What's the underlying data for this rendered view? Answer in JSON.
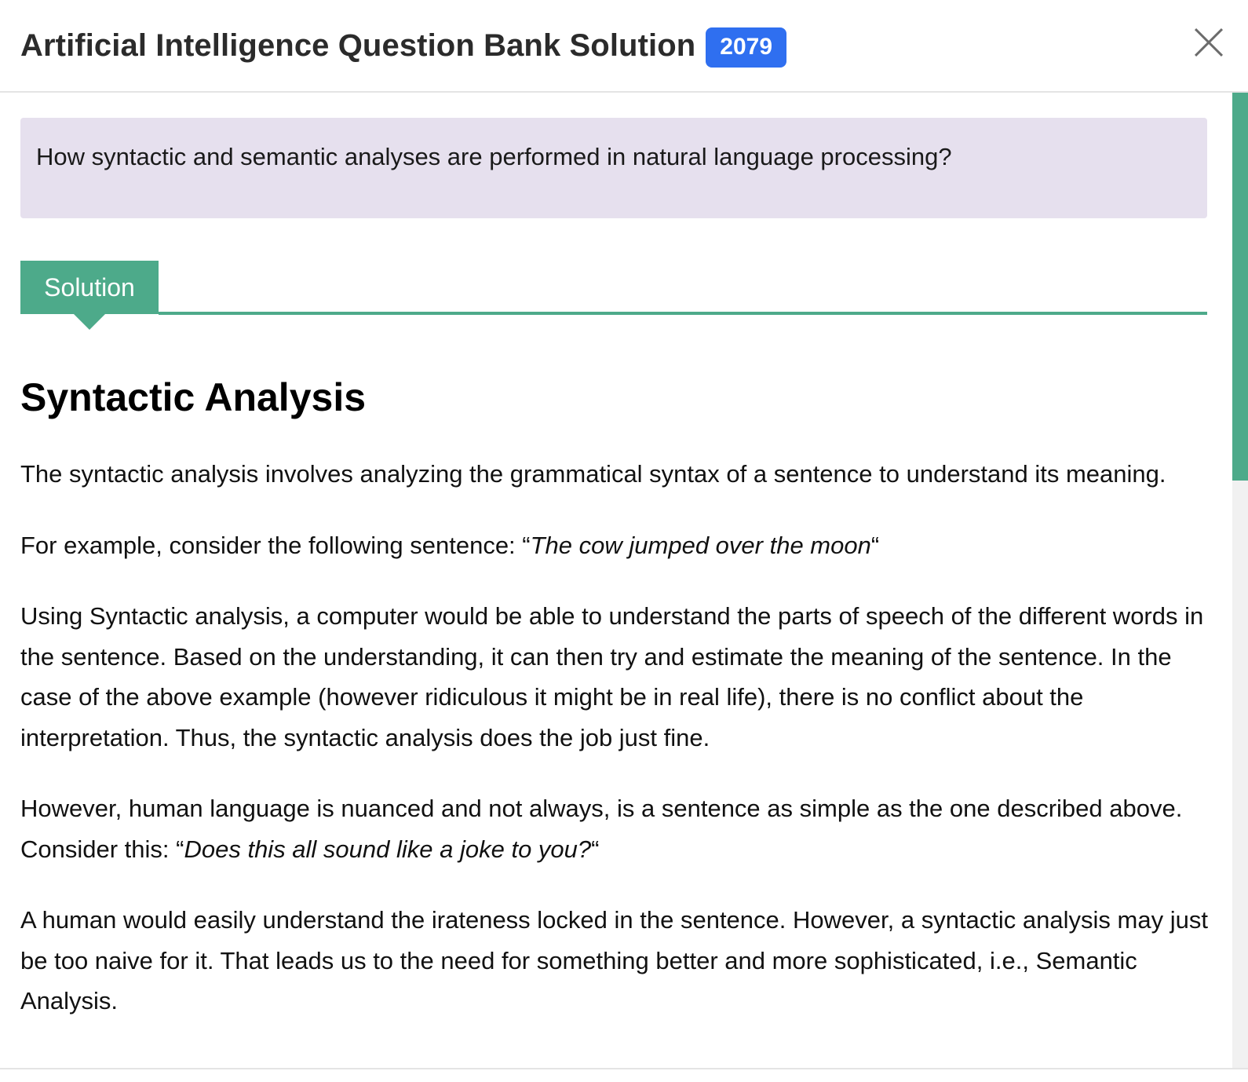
{
  "header": {
    "title": "Artificial Intelligence Question Bank Solution",
    "year": "2079"
  },
  "question": {
    "text": "How syntactic and semantic analyses are performed in natural language processing?"
  },
  "solution_tab": {
    "label": "Solution"
  },
  "content": {
    "heading": "Syntactic Analysis",
    "p1": "The syntactic analysis involves analyzing the grammatical syntax of a sentence to understand its meaning.",
    "p2_prefix": "For example, consider the following sentence: “",
    "p2_quote": "The cow jumped over the moon",
    "p2_suffix": "“",
    "p3": "Using Syntactic analysis, a computer would be able to understand the parts of speech of the different words in the sentence. Based on the understanding, it can then try and estimate the meaning of the sentence. In the case of the above example (however ridiculous it might be in real life), there is no conflict about the interpretation. Thus, the syntactic analysis does the job just fine.",
    "p4_prefix": "However, human language is nuanced and not always, is a sentence as simple as the one described above. Consider this: “",
    "p4_quote": "Does this all sound like a joke to you?",
    "p4_suffix": "“",
    "p5": "A human would easily understand the irateness locked in the sentence. However, a syntactic analysis may just be too naive for it. That leads us to the need for something better and more sophisticated, i.e., Semantic Analysis."
  },
  "colors": {
    "accent": "#4daa8a",
    "badge": "#2f6ff0",
    "question_bg": "#e6e0ee"
  },
  "icons": {
    "close": "close-icon"
  }
}
